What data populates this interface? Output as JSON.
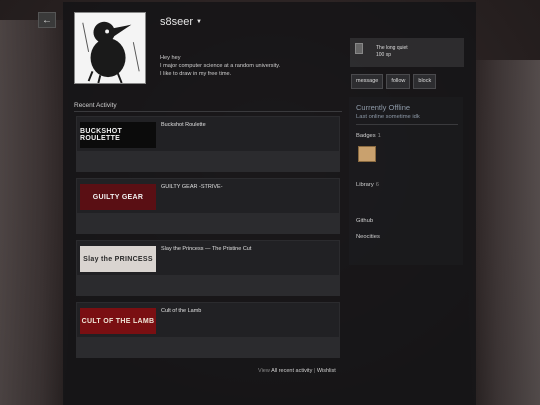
{
  "nav": {
    "back_icon": "arrow-left-icon",
    "back_glyph": "←"
  },
  "profile": {
    "name": "s8seer",
    "caret": "▼",
    "bio": [
      "Hey hey",
      "I major computer science at a random university.",
      "I like to draw in my free time."
    ]
  },
  "featured_badge": {
    "title": "The long quiet",
    "xp": "100 xp"
  },
  "actions": {
    "message": "message",
    "follow": "follow",
    "block": "block"
  },
  "activity": {
    "title": "Recent Activity",
    "games": [
      {
        "name": "Buckshot Roulette",
        "thumb": "BUCKSHOT ROULETTE",
        "bg": "#0b0b0b",
        "fg": "#f2f2f2"
      },
      {
        "name": "GUILTY GEAR -STRIVE-",
        "thumb": "GUILTY GEAR",
        "bg": "#5a0f14",
        "fg": "#f2f2f2"
      },
      {
        "name": "Slay the Princess — The Pristine Cut",
        "thumb": "Slay the PRINCESS",
        "bg": "#d9d4d0",
        "fg": "#2a2a2a"
      },
      {
        "name": "Cult of the Lamb",
        "thumb": "CULT OF THE LAMB",
        "bg": "#7a0f12",
        "fg": "#f0e6d8"
      }
    ],
    "footer": {
      "view": "View",
      "all": "All recent activity",
      "sep": "|",
      "wishlist": "Wishlist"
    }
  },
  "sidebar": {
    "status": "Currently Offline",
    "last_online": "Last online sometime idk",
    "badges_label": "Badges",
    "badges_count": "1",
    "library_label": "Library",
    "library_count": "6",
    "links": [
      "Github",
      "Neocities"
    ]
  }
}
